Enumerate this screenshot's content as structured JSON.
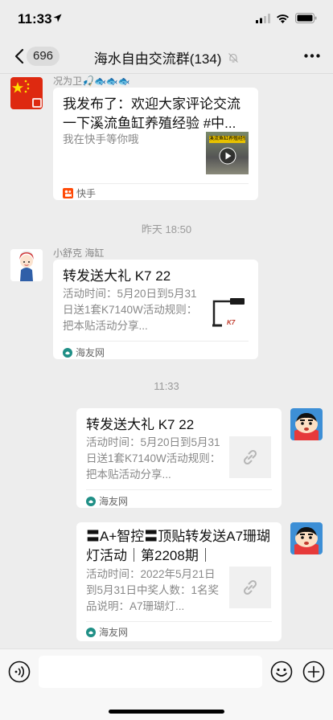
{
  "status_bar": {
    "time": "11:33"
  },
  "nav": {
    "back_count": "696",
    "title": "海水自由交流群(134)"
  },
  "messages": [
    {
      "sender": "况为卫🎣🐟🐟🐟",
      "card": {
        "title": "我发布了：欢迎大家评论交流一下溪流鱼缸养殖经验 #中...",
        "desc": "我在快手等你哦",
        "source": "快手",
        "thumb_caption": "溪流鱼缸养殖经验"
      }
    },
    {
      "time_label": "昨天 18:50"
    },
    {
      "sender": "小舒克 海缸",
      "card": {
        "title": "转发送大礼 K7 22",
        "desc": "活动时间：5月20日到5月31日送1套K7140W活动规则：把本贴活动分享...",
        "source": "海友网",
        "thumb_caption": "K7"
      }
    },
    {
      "time_label": "11:33"
    },
    {
      "card": {
        "title": "转发送大礼 K7 22",
        "desc": "活动时间：5月20日到5月31日送1套K7140W活动规则：把本贴活动分享...",
        "source": "海友网"
      }
    },
    {
      "card": {
        "title": "〓A+智控〓顶贴转发送A7珊瑚灯活动｜第2208期｜",
        "desc": "活动时间：2022年5月21日到5月31日中奖人数：1名奖品说明：A7珊瑚灯...",
        "source": "海友网"
      }
    }
  ],
  "colors": {
    "background": "#ededed",
    "card": "#ffffff",
    "kuaishou": "#ff4906",
    "secondary_text": "#888888"
  }
}
